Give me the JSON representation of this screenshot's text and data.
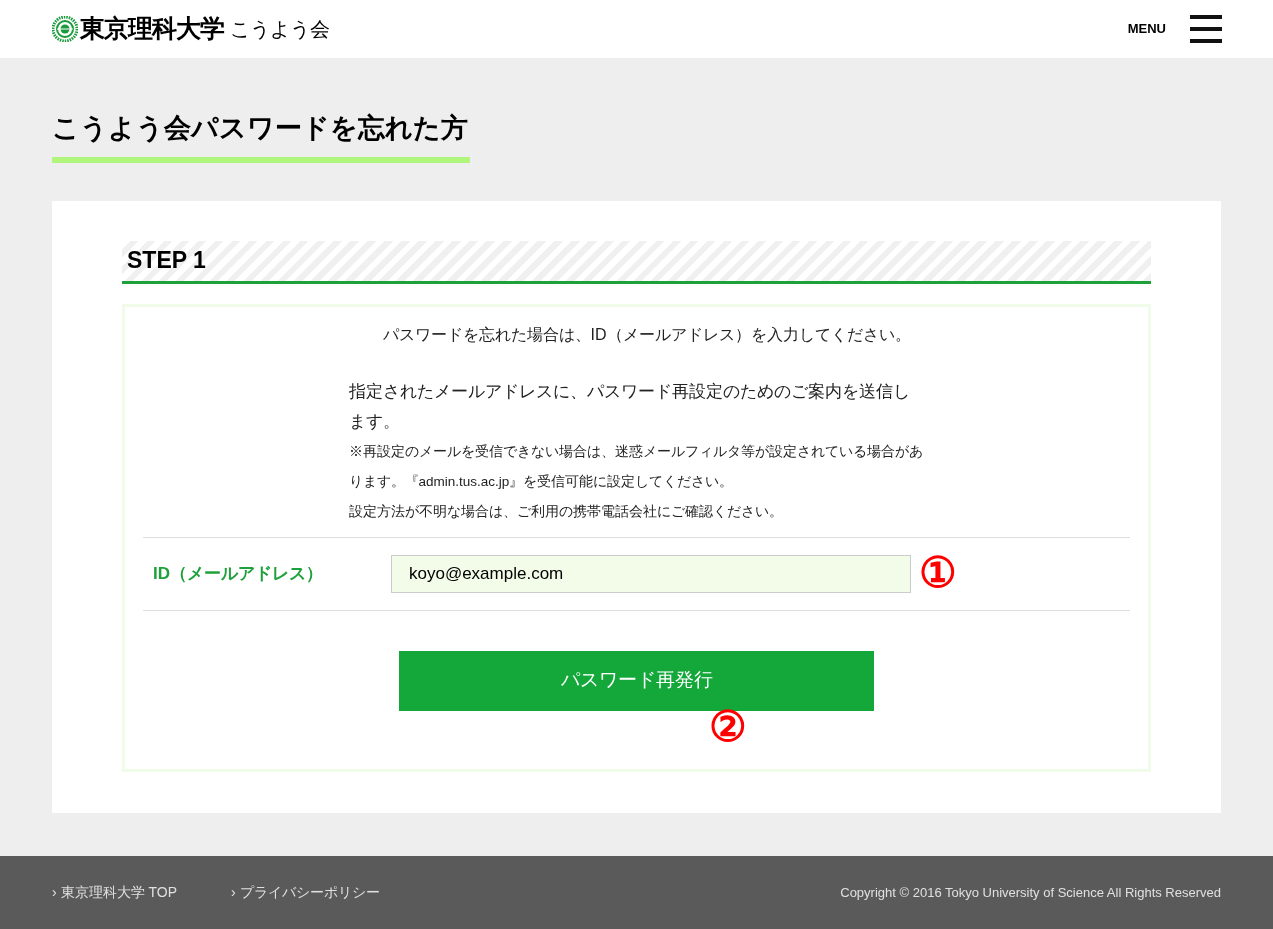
{
  "header": {
    "logo_text": "東京理科大学",
    "site_name": "こうよう会",
    "menu_label": "MENU"
  },
  "page_title": "こうよう会パスワードを忘れた方",
  "step": {
    "heading": "STEP 1",
    "intro": "パスワードを忘れた場合は、ID（メールアドレス）を入力してください。",
    "description": "指定されたメールアドレスに、パスワード再設定のためのご案内を送信します。",
    "notes": [
      "※再設定のメールを受信できない場合は、迷惑メールフィルタ等が設定されている場合があります。『admin.tus.ac.jp』を受信可能に設定してください。",
      "設定方法が不明な場合は、ご利用の携帯電話会社にご確認ください。"
    ],
    "field": {
      "label": "ID（メールアドレス）",
      "value": "koyo@example.com",
      "callout": "①"
    },
    "submit": {
      "label": "パスワード再発行",
      "callout": "②"
    }
  },
  "footer": {
    "links": [
      {
        "arrow": "›",
        "label": "東京理科大学 TOP"
      },
      {
        "arrow": "›",
        "label": "プライバシーポリシー"
      }
    ],
    "copyright": "Copyright © 2016 Tokyo University of Science All Rights Reserved"
  }
}
